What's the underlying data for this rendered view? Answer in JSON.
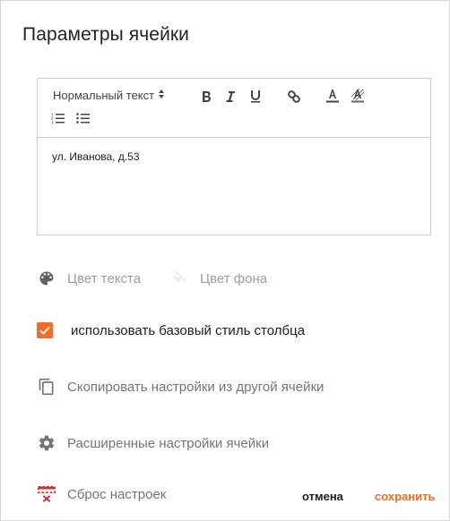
{
  "dialog": {
    "title": "Параметры ячейки"
  },
  "toolbar": {
    "format_select": "Нормальный текст",
    "buttons": [
      "bold-icon",
      "italic-icon",
      "underline-icon",
      "link-icon",
      "text-color-icon",
      "background-color-icon",
      "ordered-list-icon",
      "bullet-list-icon"
    ]
  },
  "editor": {
    "content": "ул. Иванова, д.53"
  },
  "options": {
    "text_color": "Цвет текста",
    "bg_color": "Цвет фона",
    "use_base_style": "использовать базовый стиль столбца",
    "use_base_style_checked": true,
    "copy_settings": "Скопировать настройки из другой ячейки",
    "advanced_settings": "Расширенные настройки ячейки",
    "reset_settings": "Сброс настроек"
  },
  "actions": {
    "cancel": "отмена",
    "save": "сохранить"
  },
  "colors": {
    "accent": "#f26b2a",
    "reset_icon": "#d32f2f"
  }
}
